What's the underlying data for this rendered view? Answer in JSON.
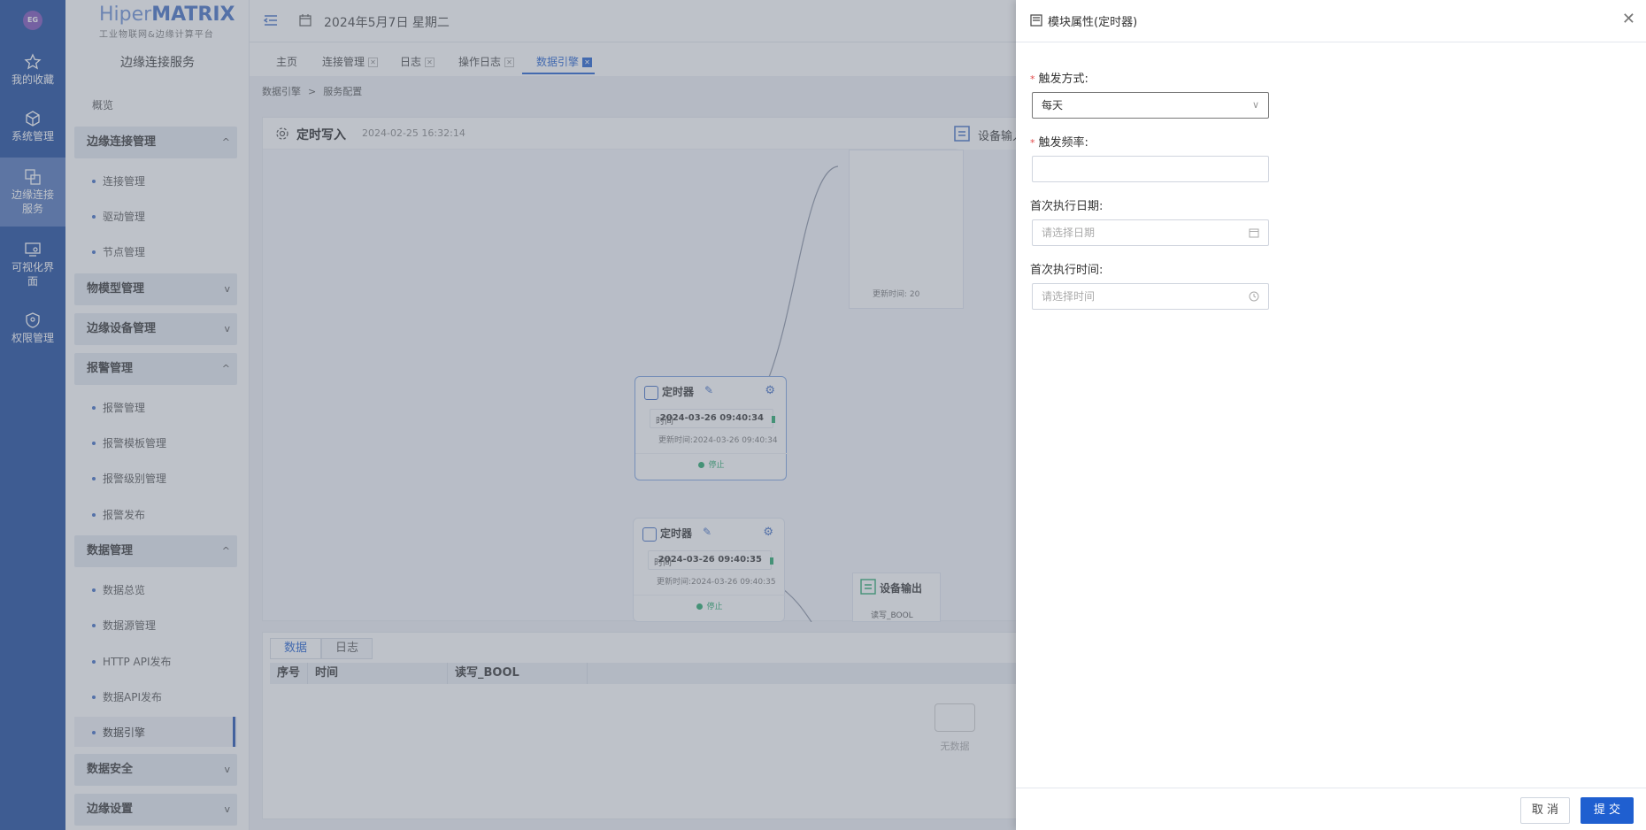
{
  "rail": {
    "logo": "EG",
    "items": [
      {
        "label": "我的收藏",
        "icon": "star-icon"
      },
      {
        "label": "系统管理",
        "icon": "cube-icon"
      },
      {
        "label": "边缘连接\n服务",
        "icon": "link-icon"
      },
      {
        "label": "可视化界\n面",
        "icon": "monitor-icon"
      },
      {
        "label": "权限管理",
        "icon": "shield-icon"
      }
    ]
  },
  "brand": {
    "prefix": "Hiper",
    "name": "MATRIX",
    "subtitle": "工业物联网&边缘计算平台"
  },
  "nav": {
    "title": "边缘连接服务",
    "overview": "概览",
    "groups": [
      {
        "label": "边缘连接管理",
        "chev": "^"
      },
      {
        "label": "物模型管理",
        "chev": "v"
      },
      {
        "label": "边缘设备管理",
        "chev": "v"
      },
      {
        "label": "报警管理",
        "chev": "^"
      },
      {
        "label": "数据管理",
        "chev": "^"
      },
      {
        "label": "数据安全",
        "chev": "v"
      },
      {
        "label": "边缘设置",
        "chev": "v"
      }
    ],
    "subs": [
      "连接管理",
      "驱动管理",
      "节点管理",
      "报警管理",
      "报警模板管理",
      "报警级别管理",
      "报警发布",
      "数据总览",
      "数据源管理",
      "HTTP API发布",
      "数据API发布",
      "数据引擎"
    ]
  },
  "topbar": {
    "date": "2024年5月7日 星期二"
  },
  "tabs": [
    {
      "label": "主页"
    },
    {
      "label": "连接管理"
    },
    {
      "label": "日志"
    },
    {
      "label": "操作日志"
    },
    {
      "label": "数据引擎"
    }
  ],
  "breadcrumb": [
    "数据引擎",
    ">",
    "服务配置"
  ],
  "canvas": {
    "title": "定时写入",
    "timestamp": "2024-02-25 16:32:14",
    "device_input": "设备输入",
    "device_output": "设备输出",
    "big_box_update": "更新时间: 20",
    "output_row": "读写_BOOL",
    "nodes": [
      {
        "title": "定时器",
        "key": "时间",
        "value": "2024-03-26 09:40:34",
        "updated": "更新时间:2024-03-26 09:40:34",
        "status": "停止"
      },
      {
        "title": "定时器",
        "key": "时间",
        "value": "2024-03-26 09:40:35",
        "updated": "更新时间:2024-03-26 09:40:35",
        "status": "停止"
      }
    ]
  },
  "bottom": {
    "tabs": [
      "数据",
      "日志"
    ],
    "columns": [
      "序号",
      "时间",
      "读写_BOOL"
    ],
    "empty": "无数据"
  },
  "drawer": {
    "title": "模块属性(定时器)",
    "fields": [
      {
        "label": "触发方式:",
        "required": "*",
        "value": "每天",
        "suffix": "∨"
      },
      {
        "label": "触发频率:",
        "required": "*",
        "value": ""
      },
      {
        "label": "首次执行日期:",
        "placeholder": "请选择日期"
      },
      {
        "label": "首次执行时间:",
        "placeholder": "请选择时间"
      }
    ],
    "cancel": "取 消",
    "submit": "提 交"
  },
  "colors": {
    "rail": "#17459c",
    "accent": "#1f5fd0",
    "status": "#23a86a"
  }
}
